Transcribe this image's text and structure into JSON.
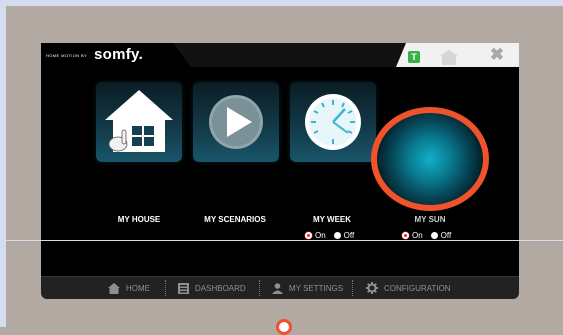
{
  "brand": {
    "tagline": "HOME MOTION BY",
    "name": "somfy."
  },
  "titlebar": {
    "badge_letter": "T",
    "close_label": "✖"
  },
  "tiles": [
    {
      "label": "MY HOUSE",
      "icon": "house-hand-icon"
    },
    {
      "label": "MY SCENARIOS",
      "icon": "play-icon"
    },
    {
      "label": "MY WEEK",
      "icon": "clock-icon"
    },
    {
      "label": "MY SUN",
      "icon": "spotlight-icon"
    }
  ],
  "week_toggle": {
    "on_label": "On",
    "off_label": "Off",
    "selected": "On"
  },
  "sun_toggle": {
    "on_label": "On",
    "off_label": "Off",
    "selected": "On"
  },
  "nav": {
    "home": "HOME",
    "dashboard": "DASHBOARD",
    "settings": "MY SETTINGS",
    "configuration": "CONFIGURATION"
  },
  "colors": {
    "accent_red": "#f0532c",
    "tile_teal": "#18556a",
    "badge_green": "#38b044"
  }
}
